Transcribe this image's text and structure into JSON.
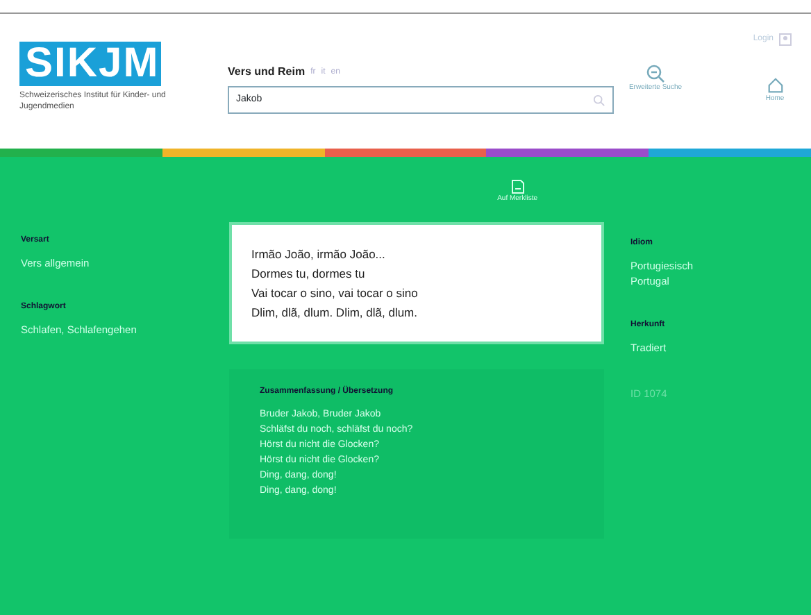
{
  "header": {
    "logo": "SIKJM",
    "institute": "Schweizerisches Institut für Kinder- und Jugendmedien",
    "title": "Vers und Reim",
    "languages": [
      {
        "label": "fr",
        "selected": false
      },
      {
        "label": "it",
        "selected": false
      },
      {
        "label": "en",
        "selected": false
      }
    ],
    "search": {
      "value": "Jakob"
    },
    "login": "Login",
    "advanced_search": "Erweiterte Suche",
    "home": "Home"
  },
  "color_bar": [
    {
      "color": "#22b14c"
    },
    {
      "color": "#f0b429"
    },
    {
      "color": "#e8604c"
    },
    {
      "color": "#9b4dca"
    },
    {
      "color": "#1fa8d8"
    }
  ],
  "save": "Auf Merkliste",
  "left": [
    {
      "label": "Versart",
      "values": [
        "Vers allgemein"
      ]
    },
    {
      "label": "Schlagwort",
      "values": [
        "Schlafen, Schlafengehen"
      ]
    }
  ],
  "verse": [
    "Irmão João, irmão João...",
    "Dormes tu, dormes tu",
    "Vai tocar o sino, vai tocar o sino",
    "Dlim, dlã, dlum. Dlim, dlã, dlum."
  ],
  "summary": {
    "label": "Zusammenfassung / Übersetzung",
    "lines": [
      "Bruder Jakob, Bruder Jakob",
      "Schläfst du noch, schläfst du noch?",
      "Hörst du nicht die Glocken?",
      "Hörst du nicht die Glocken?",
      "Ding, dang, dong!",
      "Ding, dang, dong!"
    ]
  },
  "right": [
    {
      "label": "Idiom",
      "values": [
        "Portugiesisch",
        "Portugal"
      ]
    },
    {
      "label": "Herkunft",
      "values": [
        "Tradiert"
      ]
    }
  ],
  "record_id": "ID 1074"
}
